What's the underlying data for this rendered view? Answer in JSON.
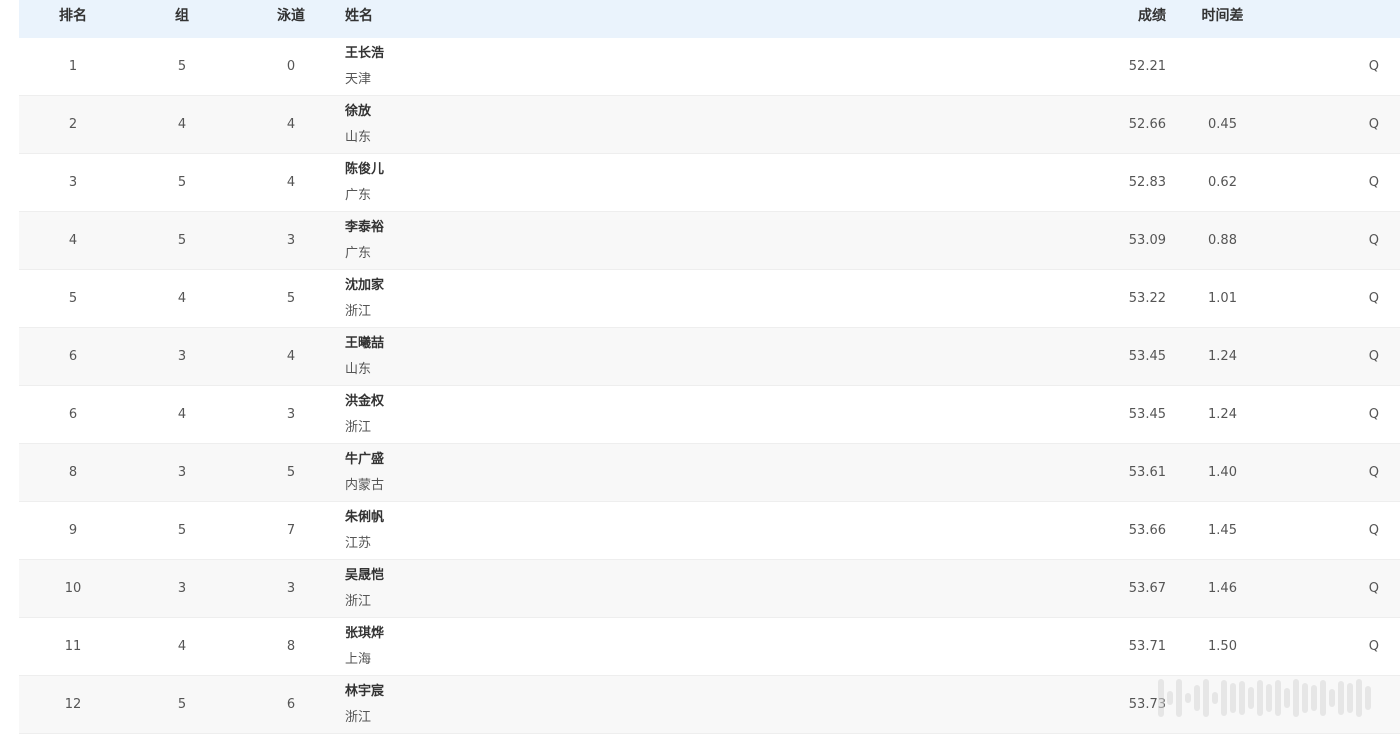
{
  "headers": {
    "rank": "排名",
    "group": "组",
    "lane": "泳道",
    "name": "姓名",
    "result": "成绩",
    "diff": "时间差",
    "qualifier": ""
  },
  "rows": [
    {
      "rank": "1",
      "group": "5",
      "lane": "0",
      "name": "王长浩",
      "team": "天津",
      "result": "52.21",
      "diff": "",
      "q": "Q"
    },
    {
      "rank": "2",
      "group": "4",
      "lane": "4",
      "name": "徐放",
      "team": "山东",
      "result": "52.66",
      "diff": "0.45",
      "q": "Q"
    },
    {
      "rank": "3",
      "group": "5",
      "lane": "4",
      "name": "陈俊儿",
      "team": "广东",
      "result": "52.83",
      "diff": "0.62",
      "q": "Q"
    },
    {
      "rank": "4",
      "group": "5",
      "lane": "3",
      "name": "李泰裕",
      "team": "广东",
      "result": "53.09",
      "diff": "0.88",
      "q": "Q"
    },
    {
      "rank": "5",
      "group": "4",
      "lane": "5",
      "name": "沈加家",
      "team": "浙江",
      "result": "53.22",
      "diff": "1.01",
      "q": "Q"
    },
    {
      "rank": "6",
      "group": "3",
      "lane": "4",
      "name": "王曦喆",
      "team": "山东",
      "result": "53.45",
      "diff": "1.24",
      "q": "Q"
    },
    {
      "rank": "6",
      "group": "4",
      "lane": "3",
      "name": "洪金权",
      "team": "浙江",
      "result": "53.45",
      "diff": "1.24",
      "q": "Q"
    },
    {
      "rank": "8",
      "group": "3",
      "lane": "5",
      "name": "牛广盛",
      "team": "内蒙古",
      "result": "53.61",
      "diff": "1.40",
      "q": "Q"
    },
    {
      "rank": "9",
      "group": "5",
      "lane": "7",
      "name": "朱俐帆",
      "team": "江苏",
      "result": "53.66",
      "diff": "1.45",
      "q": "Q"
    },
    {
      "rank": "10",
      "group": "3",
      "lane": "3",
      "name": "吴晟恺",
      "team": "浙江",
      "result": "53.67",
      "diff": "1.46",
      "q": "Q"
    },
    {
      "rank": "11",
      "group": "4",
      "lane": "8",
      "name": "张琪烨",
      "team": "上海",
      "result": "53.71",
      "diff": "1.50",
      "q": "Q"
    },
    {
      "rank": "12",
      "group": "5",
      "lane": "6",
      "name": "林宇宸",
      "team": "浙江",
      "result": "53.73",
      "diff": "",
      "q": ""
    }
  ],
  "colors": {
    "header_bg": "#eaf3fc",
    "stripe_bg": "#f8f8f8"
  },
  "watermark_icon": "barcode-watermark-icon"
}
